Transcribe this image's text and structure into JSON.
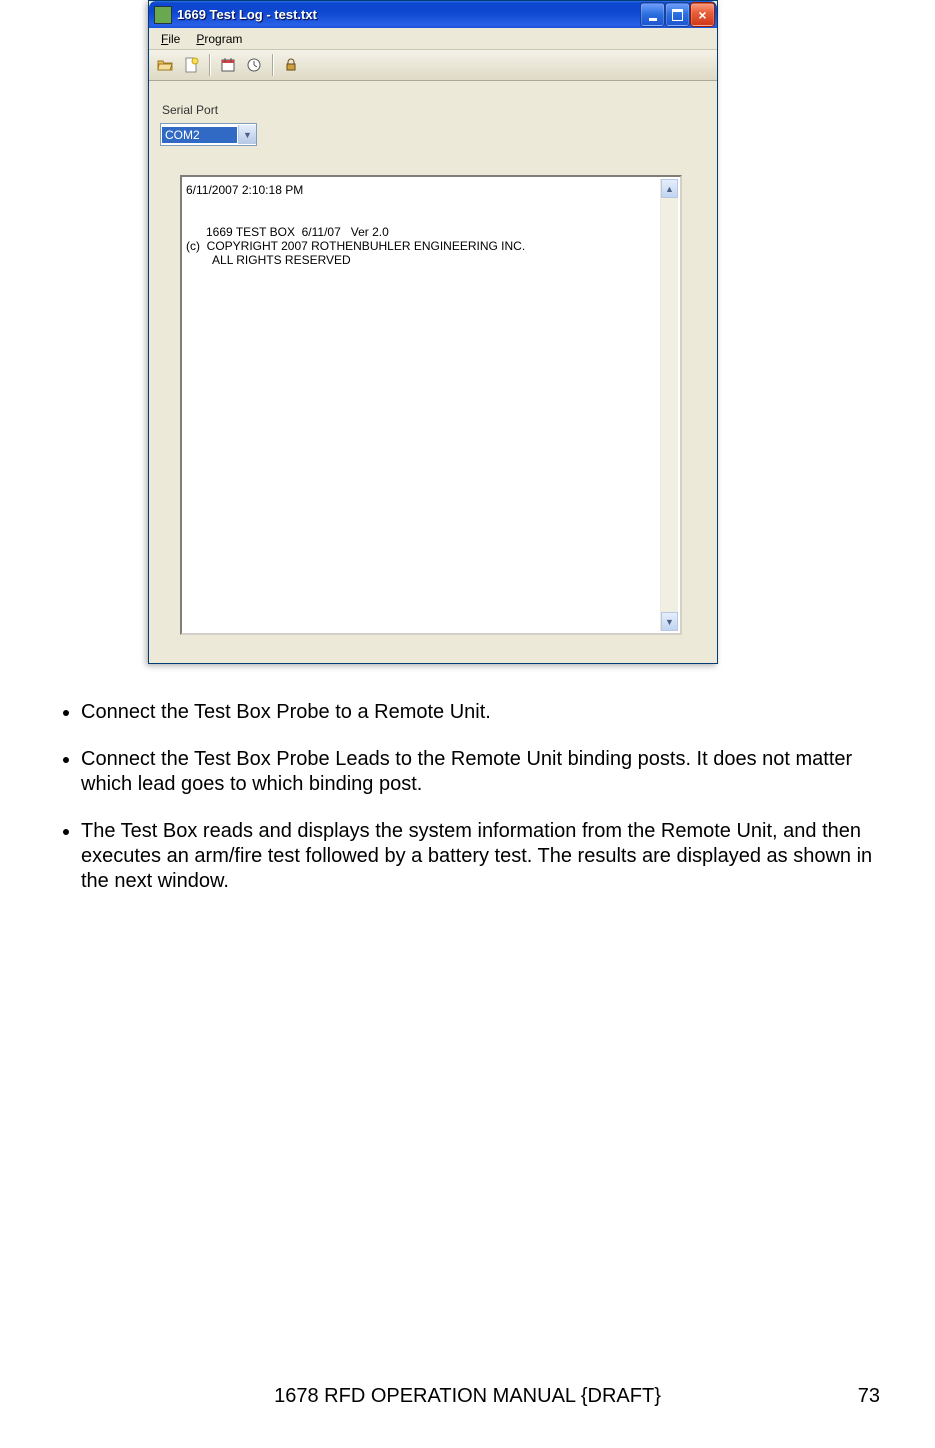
{
  "window": {
    "title": "1669 Test Log - test.txt",
    "menu": {
      "file": "File",
      "program": "Program"
    },
    "serial_label": "Serial Port",
    "serial_value": "COM2",
    "log": {
      "timestamp": "6/11/2007 2:10:18 PM",
      "line1": "      1669 TEST BOX  6/11/07   Ver 2.0",
      "line2": "(c)  COPYRIGHT 2007 ROTHENBUHLER ENGINEERING INC.",
      "line3": "        ALL RIGHTS RESERVED"
    }
  },
  "bullets": [
    "Connect the Test Box Probe to a Remote Unit.",
    "Connect the Test Box Probe Leads to the Remote Unit binding posts.  It does not matter which lead goes to which binding post.",
    "The Test Box reads and displays the system information from the Remote Unit, and then executes an arm/fire test followed by a battery test.  The results are displayed as shown in the next window."
  ],
  "footer": {
    "title": "1678 RFD OPERATION MANUAL {DRAFT}",
    "page": "73"
  }
}
